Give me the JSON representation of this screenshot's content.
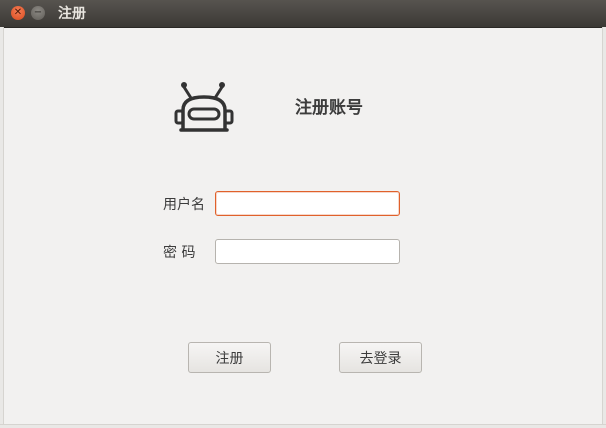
{
  "window": {
    "title": "注册",
    "close_icon": "close-icon",
    "minimize_icon": "minimize-icon"
  },
  "header": {
    "logo_icon": "robot-icon",
    "title": "注册账号"
  },
  "form": {
    "username_label": "用户名",
    "username_value": "",
    "password_label": "密 码",
    "password_value": ""
  },
  "actions": {
    "register_label": "注册",
    "goto_login_label": "去登录"
  },
  "colors": {
    "focus_border": "#e0612b",
    "titlebar": "#3b3935",
    "background": "#f2f1f0"
  }
}
